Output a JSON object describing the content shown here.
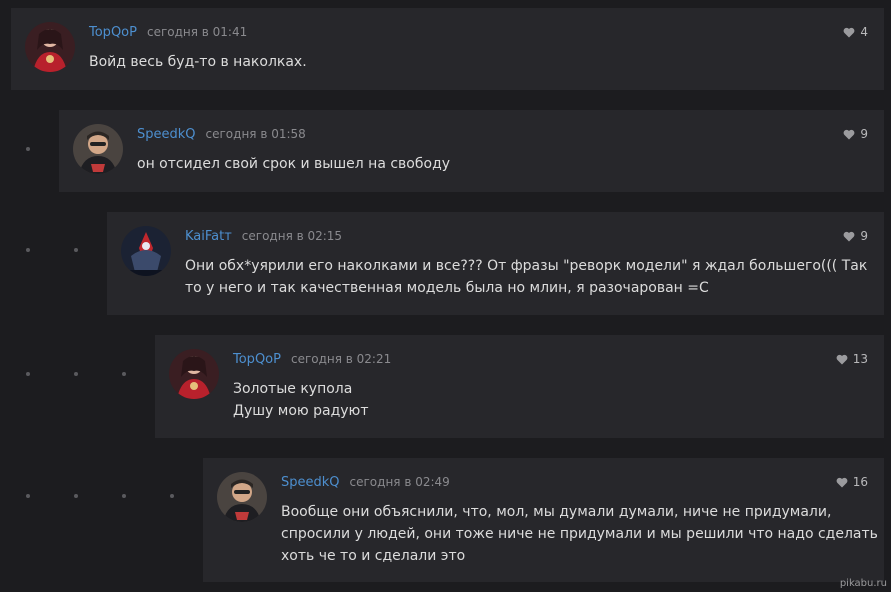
{
  "comments": [
    {
      "author": "TopQoP",
      "time": "сегодня в 01:41",
      "rating": "4",
      "lines": [
        "Войд весь буд-то в наколках."
      ]
    },
    {
      "author": "SpeedkQ",
      "time": "сегодня в 01:58",
      "rating": "9",
      "lines": [
        "он отсидел свой срок и вышел на свободу"
      ]
    },
    {
      "author": "KaiFatт",
      "time": "сегодня в 02:15",
      "rating": "9",
      "lines": [
        "Они обх*уярили его наколками и все??? От фразы \"реворк модели\" я ждал большего((( Так",
        "то у него и так качественная модель была но млин, я разочарован =С"
      ]
    },
    {
      "author": "TopQoP",
      "time": "сегодня в 02:21",
      "rating": "13",
      "lines": [
        "Золотые купола",
        "Душу мою радуют"
      ]
    },
    {
      "author": "SpeedkQ",
      "time": "сегодня в 02:49",
      "rating": "16",
      "lines": [
        "Вообще они объяснили, что, мол, мы думали думали, ниче не придумали,",
        "спросили у людей, они тоже ниче не придумали и мы решили что надо сделать",
        "хоть че то и сделали это"
      ]
    }
  ],
  "watermark": "pikabu.ru",
  "icons": {
    "rating": "heart-icon"
  },
  "colors": {
    "author": "#4d8fcf",
    "background": "#1c1c1f",
    "card": "#27272b"
  }
}
